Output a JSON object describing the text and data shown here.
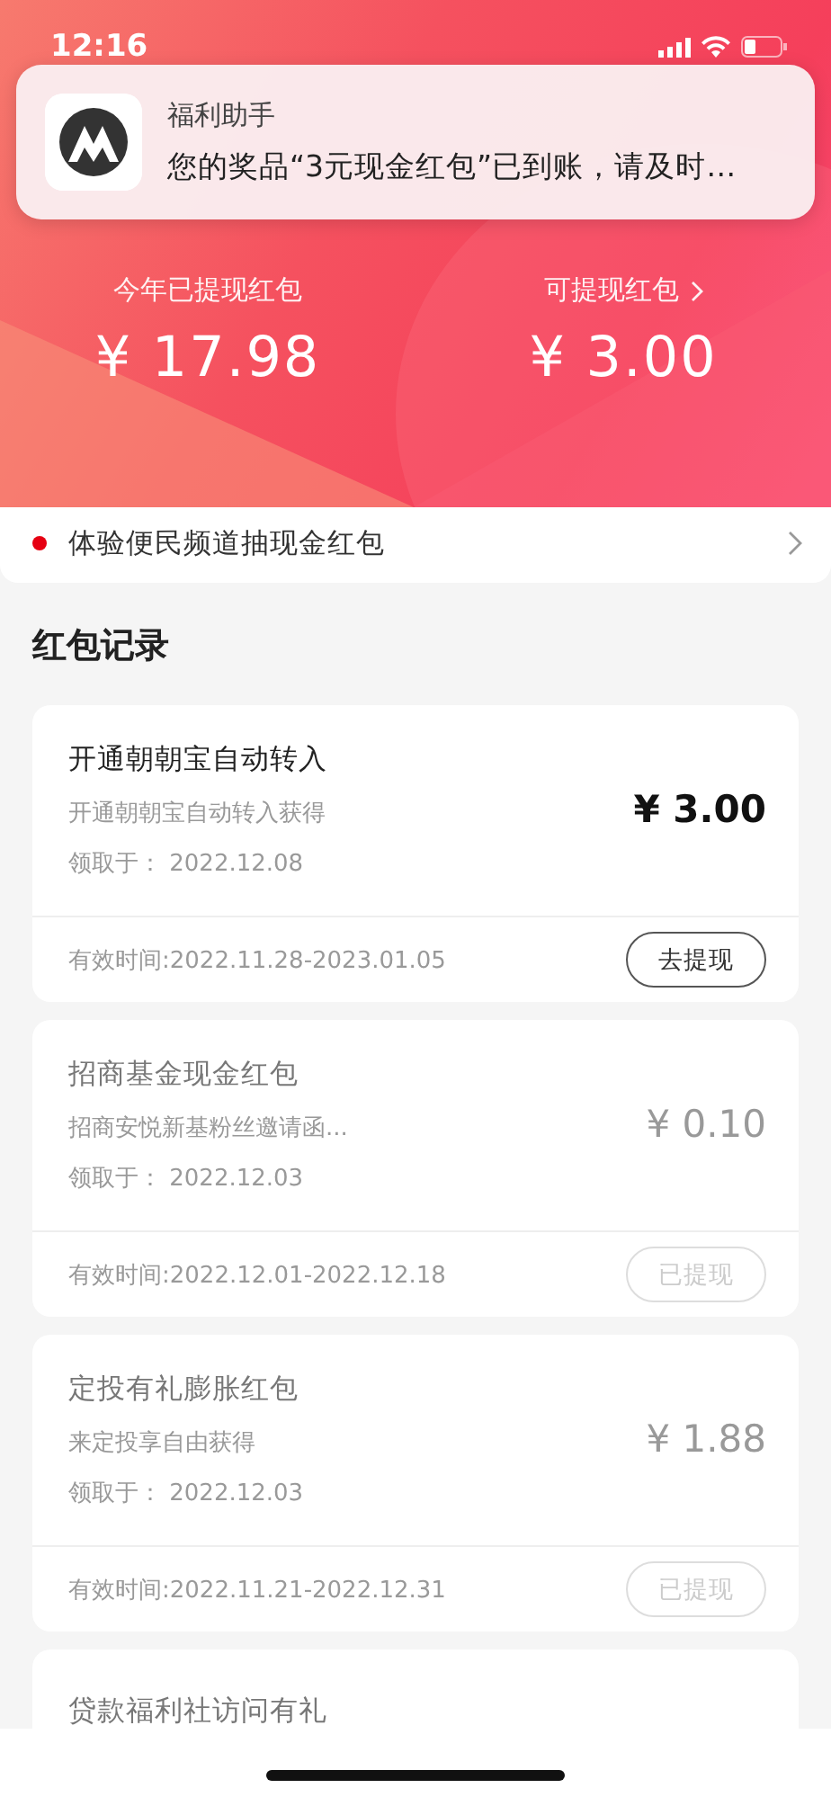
{
  "status_bar": {
    "time": "12:16"
  },
  "notification": {
    "app": "福利助手",
    "message": "您的奖品“3元现金红包”已到账，请及时…"
  },
  "summary": [
    {
      "label": "今年已提现红包",
      "amount": "¥ 17.98",
      "link": false
    },
    {
      "label": "可提现红包",
      "amount": "¥ 3.00",
      "link": true
    }
  ],
  "banner": {
    "text": "体验便民频道抽现金红包",
    "color": "#e60012"
  },
  "section_title": "红包记录",
  "records": [
    {
      "title": "开通朝朝宝自动转入",
      "source": "开通朝朝宝自动转入获得",
      "received": "领取于：  2022.12.08",
      "amount": "¥ 3.00",
      "validity": "有效时间:2022.11.28-2023.01.05",
      "button": "去提现",
      "disabled": false
    },
    {
      "title": "招商基金现金红包",
      "source": "招商安悦新基粉丝邀请函...",
      "received": "领取于：  2022.12.03",
      "amount": "¥ 0.10",
      "validity": "有效时间:2022.12.01-2022.12.18",
      "button": "已提现",
      "disabled": true
    },
    {
      "title": "定投有礼膨胀红包",
      "source": "来定投享自由获得",
      "received": "领取于：  2022.12.03",
      "amount": "¥ 1.88",
      "validity": "有效时间:2022.11.21-2022.12.31",
      "button": "已提现",
      "disabled": true
    },
    {
      "title": "贷款福利社访问有礼",
      "partial": true,
      "disabled": true
    }
  ]
}
